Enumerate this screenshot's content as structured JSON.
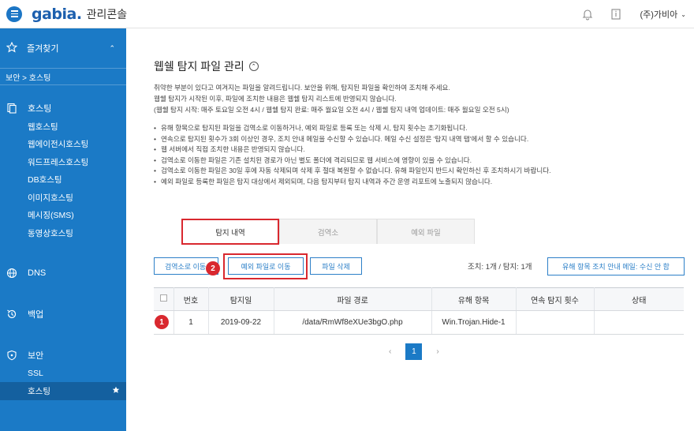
{
  "header": {
    "logo": "gabia.",
    "console_title": "관리콘솔",
    "user": "(주)가비아"
  },
  "sidebar": {
    "favorites": "즐겨찾기",
    "breadcrumb": "보안 > 호스팅",
    "groups": [
      {
        "label": "호스팅",
        "icon": "hosting-icon",
        "items": [
          "웹호스팅",
          "웹에이전시호스팅",
          "워드프레스호스팅",
          "DB호스팅",
          "이미지호스팅",
          "메시징(SMS)",
          "동영상호스팅"
        ]
      },
      {
        "label": "DNS",
        "icon": "globe-icon",
        "items": []
      },
      {
        "label": "백업",
        "icon": "backup-icon",
        "items": []
      },
      {
        "label": "보안",
        "icon": "shield-icon",
        "items": [
          "SSL",
          "호스팅"
        ]
      }
    ]
  },
  "page": {
    "title": "웹쉘 탐지 파일 관리",
    "intro": [
      "취약한 부분이 있다고 여겨지는 파일을 알려드립니다. 보안을 위해, 탐지된 파일을 확인하여 조치해 주세요.",
      "웹쉘 탐지가 시작된 이후, 파일에 조치한 내용은 웹쉘 탐지 리스트에 반영되지 않습니다.",
      "(웹쉘 탐지 시작: 매주 토요일 오전 4시 / 웹쉘 탐지 완료: 매주 월요일 오전 4시 / 웹쉘 탐지 내역 업데이트: 매주 월요일 오전 5시)"
    ],
    "notes": [
      "유해 항목으로 탐지된 파일을 검역소로 이동하거나, 예외 파일로 등록 또는 삭제 시, 탐지 횟수는 초기화됩니다.",
      "연속으로 탐지된 횟수가 3회 이상인 경우, 조치 안내 메일을 수신할 수 있습니다. 메일 수신 설정은 '탐지 내역 탭'에서 할 수 있습니다.",
      "웹 서버에서 직접 조치한 내용은 반영되지 않습니다.",
      "검역소로 이동한 파일은 기존 설치된 경로가 아닌 별도 폴더에 격리되므로 웹 서비스에 영향이 있을 수 있습니다.",
      "검역소로 이동한 파일은 30일 후에 자동 삭제되며 삭제 후 절대 복원할 수 없습니다. 유해 파일인지 반드시 확인하신 후 조치하시기 바랍니다.",
      "예외 파일로 등록한 파일은 탐지 대상에서 제외되며, 다음 탐지부터 탐지 내역과 주간 운영 리포트에 노출되지 않습니다."
    ],
    "tabs": [
      "탐지 내역",
      "검역소",
      "예외 파일"
    ],
    "buttons": {
      "quarantine": "검역소로 이동",
      "exception": "예외 파일로 이동",
      "delete": "파일 삭제",
      "mail": "유해 항목 조치 안내 메일: 수신 안 함"
    },
    "counts": "조치: 1개 / 탐지: 1개",
    "table": {
      "headers": [
        "번호",
        "탐지일",
        "파일 경로",
        "유해 항목",
        "연속 탐지 횟수",
        "상태"
      ],
      "rows": [
        [
          "1",
          "2019-09-22",
          "/data/RmWf8eXUe3bgO.php",
          "Win.Trojan.Hide-1",
          "",
          ""
        ]
      ]
    },
    "pager": {
      "prev": "‹",
      "current": "1",
      "next": "›"
    },
    "markers": [
      "1",
      "2"
    ]
  }
}
